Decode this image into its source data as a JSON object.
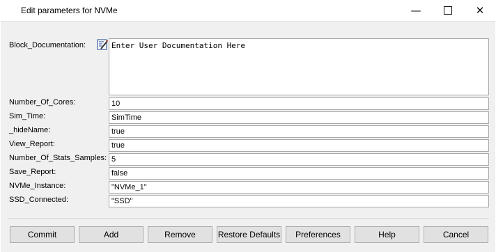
{
  "window": {
    "title": "Edit parameters for NVMe",
    "controls": {
      "minimize_icon": "minimize-icon",
      "maximize_icon": "maximize-icon",
      "close_icon": "close-icon"
    }
  },
  "doc": {
    "label": "Block_Documentation:",
    "value": "Enter User Documentation Here",
    "icon": "edit-document-icon"
  },
  "params": [
    {
      "label": "Number_Of_Cores:",
      "value": "10"
    },
    {
      "label": "Sim_Time:",
      "value": "SimTime"
    },
    {
      "label": "_hideName:",
      "value": "true"
    },
    {
      "label": "View_Report:",
      "value": "true"
    },
    {
      "label": "Number_Of_Stats_Samples:",
      "value": "5"
    },
    {
      "label": "Save_Report:",
      "value": "false"
    },
    {
      "label": "NVMe_Instance:",
      "value": "\"NVMe_1\""
    },
    {
      "label": "SSD_Connected:",
      "value": "\"SSD\""
    }
  ],
  "buttons": {
    "commit": "Commit",
    "add": "Add",
    "remove": "Remove",
    "restore_defaults": "Restore Defaults",
    "preferences": "Preferences",
    "help": "Help",
    "cancel": "Cancel"
  }
}
